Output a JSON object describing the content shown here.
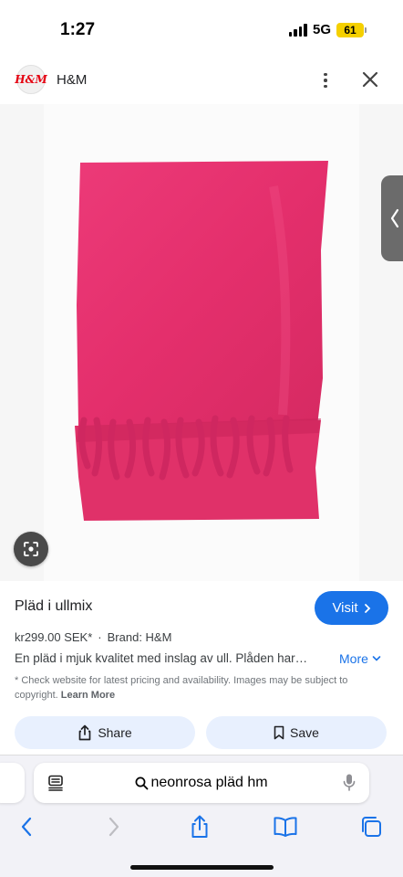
{
  "status": {
    "time": "1:27",
    "network": "5G",
    "battery": "61"
  },
  "header": {
    "logo_text": "H&M",
    "site_name": "H&M"
  },
  "product": {
    "title": "Pläd i ullmix",
    "price": "kr299.00 SEK*",
    "separator": "·",
    "brand": "Brand: H&M",
    "description": "En pläd i mjuk kvalitet med inslag av ull. Plåden har…",
    "more_label": "More",
    "disclaimer": "* Check website for latest pricing and availability. Images may be subject to copyright.",
    "learn_more": "Learn More",
    "image_color": "#e0306a"
  },
  "actions": {
    "visit_label": "Visit",
    "share_label": "Share",
    "save_label": "Save"
  },
  "browser": {
    "query": "neonrosa pläd hm"
  },
  "colors": {
    "accent": "#1a73e8",
    "chip_bg": "#e8f0fe"
  }
}
